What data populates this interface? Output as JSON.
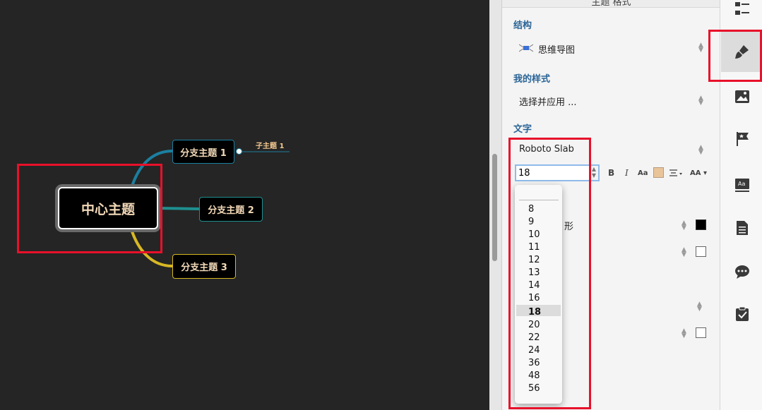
{
  "mindmap": {
    "central": "中心主题",
    "branches": [
      "分支主题 1",
      "分支主题 2",
      "分支主题 3"
    ],
    "subtopic": "子主题 1"
  },
  "panel": {
    "title": "主题 格式",
    "structure_label": "结构",
    "structure_value": "思维导图",
    "my_style_label": "我的样式",
    "my_style_value": "选择并应用 ...",
    "text_label": "文字",
    "font_name": "Roboto Slab",
    "font_size": "18",
    "bold": "B",
    "italic": "I",
    "case": "Aa",
    "size_aa": "AA",
    "shape_fragment": "形",
    "text_color": "#e9c49a"
  },
  "font_sizes": [
    "8",
    "9",
    "10",
    "11",
    "12",
    "13",
    "14",
    "16",
    "18",
    "20",
    "22",
    "24",
    "36",
    "48",
    "56"
  ],
  "selected_font_size": "18",
  "colors": {
    "canvas": "#252525",
    "central_text": "#f2d9b8",
    "branch1": "#1b7fa0",
    "branch2": "#1f8f8f",
    "branch3": "#d8b824",
    "highlight": "#e8102a"
  }
}
